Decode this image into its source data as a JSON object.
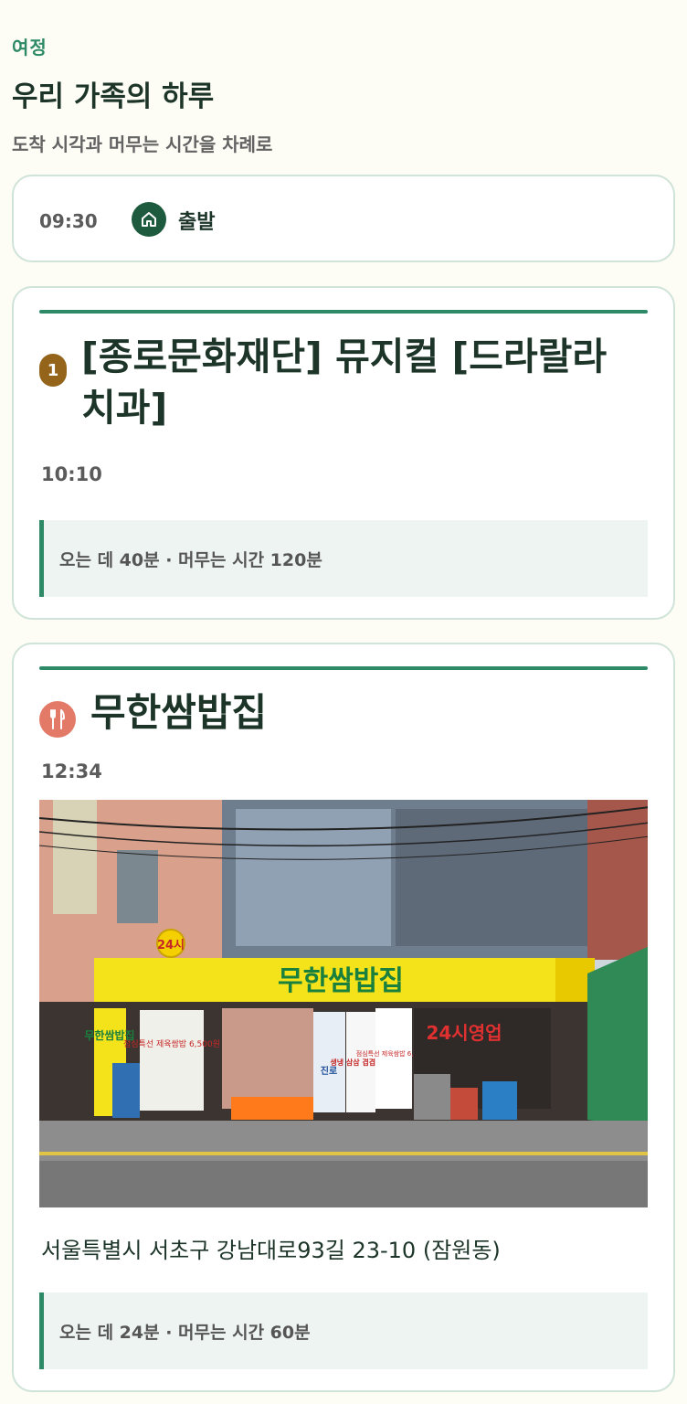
{
  "header": {
    "eyebrow": "여정",
    "title": "우리 가족의 하루",
    "subtitle": "도착 시각과 머무는 시간을 차례로"
  },
  "start": {
    "time": "09:30",
    "label": "출발",
    "icon": "home-icon"
  },
  "stops": [
    {
      "number": "1",
      "title": "[종로문화재단] 뮤지컬 [드라랄라 치과]",
      "time": "10:10",
      "info": "오는 데 40분 · 머무는 시간 120분"
    },
    {
      "icon": "fork-knife-icon",
      "title": "무한쌈밥집",
      "time": "12:34",
      "photo": {
        "sign_main": "무한쌈밥집",
        "sign_24": "24시",
        "sign_hours": "24시영업",
        "sign_side": "무한쌈밥집",
        "menu_board": "점심특선 제육쌈밥 6,500원",
        "menu_right": "점심특선 제육쌈밥 6,500원",
        "jinro": "진로",
        "banner": "생냉 삼삼 겹겹 살살"
      },
      "address": "서울특별시 서초구 강남대로93길 23-10 (잠원동)",
      "info": "오는 데 24분 · 머무는 시간 60분"
    }
  ],
  "colors": {
    "accent": "#2e8a66",
    "dark_green": "#1e5a3e",
    "badge_brown": "#94641a",
    "food_coral": "#e27a67"
  }
}
